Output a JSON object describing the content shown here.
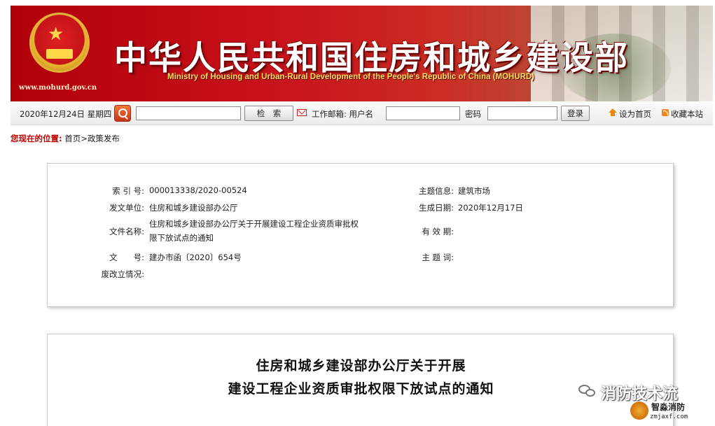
{
  "header": {
    "site_url": "www.mohurd.gov.cn",
    "title_cn": "中华人民共和国住房和城乡建设部",
    "title_en": "Ministry of Housing and Urban-Rural Development of the People's Republic of China (MOHURD)"
  },
  "toolbar": {
    "date": "2020年12月24日 星期四",
    "search_button": "检　索",
    "mail_label": "工作邮箱: 用户名",
    "password_label": "密码",
    "login_button": "登录",
    "set_home": "设为首页",
    "bookmark": "收藏本站"
  },
  "breadcrumb": {
    "here_label": "您现在的位置:",
    "path": "首页>政策发布"
  },
  "meta": {
    "index_label": "索 引 号:",
    "index_value": "000013338/2020-00524",
    "unit_label": "发文单位:",
    "unit_value": "住房和城乡建设部办公厅",
    "filename_label": "文件名称:",
    "filename_value": "住房和城乡建设部办公厅关于开展建设工程企业资质审批权限下放试点的通知",
    "docno_label": "文　　号:",
    "docno_value": "建办市函〔2020〕654号",
    "abolish_label": "废改立情况:",
    "abolish_value": "",
    "topic_label": "主题信息:",
    "topic_value": "建筑市场",
    "date_label": "生成日期:",
    "date_value": "2020年12月17日",
    "validity_label": "有 效 期:",
    "validity_value": "",
    "keywords_label": "主 题 词:",
    "keywords_value": ""
  },
  "document": {
    "title_line1": "住房和城乡建设部办公厅关于开展",
    "title_line2": "建设工程企业资质审批权限下放试点的通知"
  },
  "watermark": {
    "text": "消防技术流",
    "brand": "智淼消防",
    "domain": "zmjaxf.com"
  }
}
